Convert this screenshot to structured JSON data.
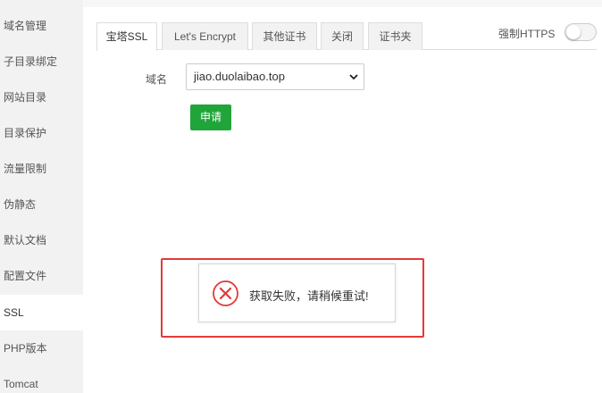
{
  "sidebar": {
    "items": [
      {
        "label": "域名管理"
      },
      {
        "label": "子目录绑定"
      },
      {
        "label": "网站目录"
      },
      {
        "label": "目录保护"
      },
      {
        "label": "流量限制"
      },
      {
        "label": "伪静态"
      },
      {
        "label": "默认文档"
      },
      {
        "label": "配置文件"
      },
      {
        "label": "SSL",
        "active": true
      },
      {
        "label": "PHP版本"
      },
      {
        "label": "Tomcat"
      }
    ]
  },
  "tabs": [
    {
      "label": "宝塔SSL",
      "active": true
    },
    {
      "label": "Let's Encrypt"
    },
    {
      "label": "其他证书"
    },
    {
      "label": "关闭"
    },
    {
      "label": "证书夹"
    }
  ],
  "https_toggle": {
    "label": "强制HTTPS",
    "enabled": false
  },
  "form": {
    "domain_label": "域名",
    "domain_value": "jiao.duolaibao.top",
    "apply_label": "申请"
  },
  "toast": {
    "message": "获取失败，请稍候重试!"
  },
  "colors": {
    "accent": "#20a53a",
    "error": "#e23a3a",
    "highlight_border": "#e23a3a"
  }
}
